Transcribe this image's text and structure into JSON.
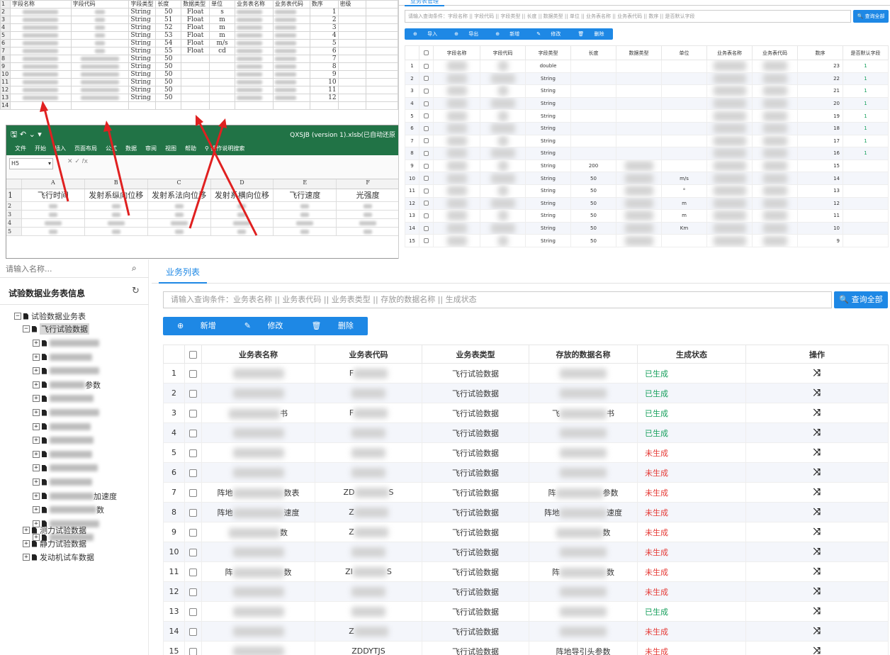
{
  "excel_sheet": {
    "headers": [
      "字段名称",
      "字段代码",
      "字段类型",
      "长度",
      "数据类型",
      "单位",
      "业务表名称",
      "业务表代码",
      "数序",
      "密级"
    ],
    "rows": [
      {
        "rn": "2",
        "type": "String",
        "len": "50",
        "dtype": "Float",
        "unit": "s",
        "seq": "1"
      },
      {
        "rn": "3",
        "type": "String",
        "len": "51",
        "dtype": "Float",
        "unit": "m",
        "seq": "2"
      },
      {
        "rn": "4",
        "type": "String",
        "len": "52",
        "dtype": "Float",
        "unit": "m",
        "seq": "3"
      },
      {
        "rn": "5",
        "type": "String",
        "len": "53",
        "dtype": "Float",
        "unit": "m",
        "seq": "4"
      },
      {
        "rn": "6",
        "type": "String",
        "len": "54",
        "dtype": "Float",
        "unit": "m/s",
        "seq": "5"
      },
      {
        "rn": "7",
        "type": "String",
        "len": "55",
        "dtype": "Float",
        "unit": "cd",
        "seq": "6"
      },
      {
        "rn": "8",
        "type": "String",
        "len": "50",
        "dtype": "",
        "unit": "",
        "seq": "7"
      },
      {
        "rn": "9",
        "type": "String",
        "len": "50",
        "dtype": "",
        "unit": "",
        "seq": "8"
      },
      {
        "rn": "10",
        "type": "String",
        "len": "50",
        "dtype": "",
        "unit": "",
        "seq": "9"
      },
      {
        "rn": "11",
        "type": "String",
        "len": "50",
        "dtype": "",
        "unit": "",
        "seq": "10"
      },
      {
        "rn": "12",
        "type": "String",
        "len": "50",
        "dtype": "",
        "unit": "",
        "seq": "11"
      },
      {
        "rn": "13",
        "type": "String",
        "len": "50",
        "dtype": "",
        "unit": "",
        "seq": "12"
      }
    ],
    "row_num_1": "1",
    "row_num_14": "14"
  },
  "excel_window": {
    "title": "QXSJB (version 1).xlsb(已自动还原",
    "menus": [
      "文件",
      "开始",
      "插入",
      "页面布局",
      "公式",
      "数据",
      "审阅",
      "视图",
      "帮助"
    ],
    "tell_me": "操作说明搜索",
    "name_box": "H5",
    "col_letters": [
      "A",
      "B",
      "C",
      "D",
      "E",
      "F"
    ],
    "headers": [
      "飞行时间",
      "发射系纵向位移",
      "发射系法向位移",
      "发射系横向位移",
      "飞行速度",
      "光强度"
    ],
    "row_nums": [
      "1",
      "2",
      "3",
      "4",
      "5"
    ]
  },
  "field_panel": {
    "tab": "业务表管理",
    "search_placeholder": "请输入查询条件：字段名称 || 字段代码 || 字段类型 || 长度 || 数据类型 || 单位 || 业务表名称 || 业务表代码 || 数序 || 是否默认字段",
    "search_btn": "查询全部",
    "tools": [
      "导入",
      "导出",
      "新增",
      "修改",
      "删除"
    ],
    "headers": [
      "",
      "字段名称",
      "字段代码",
      "字段类型",
      "长度",
      "数据类型",
      "单位",
      "业务表名称",
      "业务表代码",
      "数序",
      "是否默认字段"
    ],
    "rows": [
      {
        "n": "1",
        "type": "double",
        "len": "",
        "unit": "",
        "seq": "23",
        "def": "1"
      },
      {
        "n": "2",
        "type": "String",
        "len": "",
        "unit": "",
        "seq": "22",
        "def": "1"
      },
      {
        "n": "3",
        "type": "String",
        "len": "",
        "unit": "",
        "seq": "21",
        "def": "1"
      },
      {
        "n": "4",
        "type": "String",
        "len": "",
        "unit": "",
        "seq": "20",
        "def": "1"
      },
      {
        "n": "5",
        "type": "String",
        "len": "",
        "unit": "",
        "seq": "19",
        "def": "1"
      },
      {
        "n": "6",
        "type": "String",
        "len": "",
        "unit": "",
        "seq": "18",
        "def": "1"
      },
      {
        "n": "7",
        "type": "String",
        "len": "",
        "unit": "",
        "seq": "17",
        "def": "1"
      },
      {
        "n": "8",
        "type": "String",
        "len": "",
        "unit": "",
        "seq": "16",
        "def": "1"
      },
      {
        "n": "9",
        "type": "String",
        "len": "200",
        "unit": "",
        "seq": "15",
        "def": ""
      },
      {
        "n": "10",
        "type": "String",
        "len": "50",
        "unit": "m/s",
        "seq": "14",
        "def": ""
      },
      {
        "n": "11",
        "type": "String",
        "len": "50",
        "unit": "°",
        "seq": "13",
        "def": ""
      },
      {
        "n": "12",
        "type": "String",
        "len": "50",
        "unit": "m",
        "seq": "12",
        "def": ""
      },
      {
        "n": "13",
        "type": "String",
        "len": "50",
        "unit": "m",
        "seq": "11",
        "def": ""
      },
      {
        "n": "14",
        "type": "String",
        "len": "50",
        "unit": "Km",
        "seq": "10",
        "def": ""
      },
      {
        "n": "15",
        "type": "String",
        "len": "50",
        "unit": "",
        "seq": "9",
        "def": ""
      }
    ]
  },
  "tree_panel": {
    "search_placeholder": "请输入名称...",
    "title": "试验数据业务表信息",
    "root": "试验数据业务表",
    "flight": "飞行试验数据",
    "child_suffixes": [
      "",
      "",
      "",
      "参数",
      "",
      "",
      "",
      "",
      "",
      "",
      "",
      "加速度",
      "数",
      "",
      ""
    ],
    "siblings": [
      "测力试验数据",
      "静力试验数据",
      "发动机试车数据"
    ]
  },
  "business_list": {
    "tab": "业务列表",
    "search_placeholder": "请输入查询条件：业务表名称 || 业务表代码 || 业务表类型 || 存放的数据名称 || 生成状态",
    "search_btn": "查询全部",
    "tools": {
      "add": "新增",
      "edit": "修改",
      "del": "删除"
    },
    "headers": [
      "",
      "业务表名称",
      "业务表代码",
      "业务表类型",
      "存放的数据名称",
      "生成状态",
      "操作"
    ],
    "rows": [
      {
        "n": "1",
        "name_pre": "",
        "name_suf": "",
        "code_pre": "F",
        "code_suf": "",
        "type": "飞行试验数据",
        "data_pre": "",
        "data_suf": "",
        "status": "已生成",
        "ok": true
      },
      {
        "n": "2",
        "name_pre": "",
        "name_suf": "",
        "code_pre": "",
        "code_suf": "",
        "type": "飞行试验数据",
        "data_pre": "",
        "data_suf": "",
        "status": "已生成",
        "ok": true
      },
      {
        "n": "3",
        "name_pre": "",
        "name_suf": "书",
        "code_pre": "F",
        "code_suf": "",
        "type": "飞行试验数据",
        "data_pre": "飞",
        "data_suf": "书",
        "status": "已生成",
        "ok": true
      },
      {
        "n": "4",
        "name_pre": "",
        "name_suf": "",
        "code_pre": "",
        "code_suf": "",
        "type": "飞行试验数据",
        "data_pre": "",
        "data_suf": "",
        "status": "已生成",
        "ok": true
      },
      {
        "n": "5",
        "name_pre": "",
        "name_suf": "",
        "code_pre": "",
        "code_suf": "",
        "type": "飞行试验数据",
        "data_pre": "",
        "data_suf": "",
        "status": "未生成",
        "ok": false
      },
      {
        "n": "6",
        "name_pre": "",
        "name_suf": "",
        "code_pre": "",
        "code_suf": "",
        "type": "飞行试验数据",
        "data_pre": "",
        "data_suf": "",
        "status": "未生成",
        "ok": false
      },
      {
        "n": "7",
        "name_pre": "阵地",
        "name_suf": "数表",
        "code_pre": "ZD",
        "code_suf": "S",
        "type": "飞行试验数据",
        "data_pre": "阵",
        "data_suf": "参数",
        "status": "未生成",
        "ok": false
      },
      {
        "n": "8",
        "name_pre": "阵地",
        "name_suf": "速度",
        "code_pre": "Z",
        "code_suf": "",
        "type": "飞行试验数据",
        "data_pre": "阵地",
        "data_suf": "速度",
        "status": "未生成",
        "ok": false
      },
      {
        "n": "9",
        "name_pre": "",
        "name_suf": "数",
        "code_pre": "Z",
        "code_suf": "",
        "type": "飞行试验数据",
        "data_pre": "",
        "data_suf": "数",
        "status": "未生成",
        "ok": false
      },
      {
        "n": "10",
        "name_pre": "",
        "name_suf": "",
        "code_pre": "",
        "code_suf": "",
        "type": "飞行试验数据",
        "data_pre": "",
        "data_suf": "",
        "status": "未生成",
        "ok": false
      },
      {
        "n": "11",
        "name_pre": "阵",
        "name_suf": "数",
        "code_pre": "ZI",
        "code_suf": "S",
        "type": "飞行试验数据",
        "data_pre": "阵",
        "data_suf": "数",
        "status": "未生成",
        "ok": false
      },
      {
        "n": "12",
        "name_pre": "",
        "name_suf": "",
        "code_pre": "",
        "code_suf": "",
        "type": "飞行试验数据",
        "data_pre": "",
        "data_suf": "",
        "status": "未生成",
        "ok": false
      },
      {
        "n": "13",
        "name_pre": "",
        "name_suf": "",
        "code_pre": "",
        "code_suf": "",
        "type": "飞行试验数据",
        "data_pre": "",
        "data_suf": "",
        "status": "已生成",
        "ok": true
      },
      {
        "n": "14",
        "name_pre": "",
        "name_suf": "",
        "code_pre": "Z",
        "code_suf": "",
        "type": "飞行试验数据",
        "data_pre": "",
        "data_suf": "",
        "status": "未生成",
        "ok": false
      },
      {
        "n": "15",
        "name_pre": "",
        "name_suf": "",
        "code_pre": "ZDDYTJS",
        "code_suf": "",
        "type": "飞行试验数据",
        "data_pre": "阵地导引头参数",
        "data_suf": "",
        "status": "未生成",
        "ok": false
      }
    ]
  },
  "colors": {
    "primary": "#1e88e5",
    "ok": "#17a05d",
    "no": "#e53935",
    "excel_green": "#217346",
    "arrow": "#e02020"
  }
}
